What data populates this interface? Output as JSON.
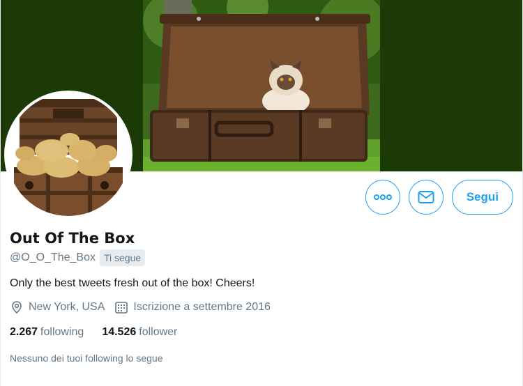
{
  "profile": {
    "name": "Out Of The Box",
    "handle": "@O_O_The_Box",
    "follows_you_badge": "Ti segue",
    "bio": "Only the best tweets fresh out of the box! Cheers!",
    "location": "New York, USA",
    "joined": "Iscrizione a settembre 2016",
    "following_count": "2.267",
    "following_label": "following",
    "followers_count": "14.526",
    "followers_label": "follower",
    "followers_you_know": "Nessuno dei tuoi following lo segue"
  },
  "actions": {
    "more_icon": "more-dots-icon",
    "message_icon": "envelope-icon",
    "follow_label": "Segui"
  },
  "colors": {
    "accent": "#1da1f2",
    "banner_bg": "#1c3a05",
    "secondary_text": "#657786",
    "badge_bg": "#e6ecf0"
  }
}
